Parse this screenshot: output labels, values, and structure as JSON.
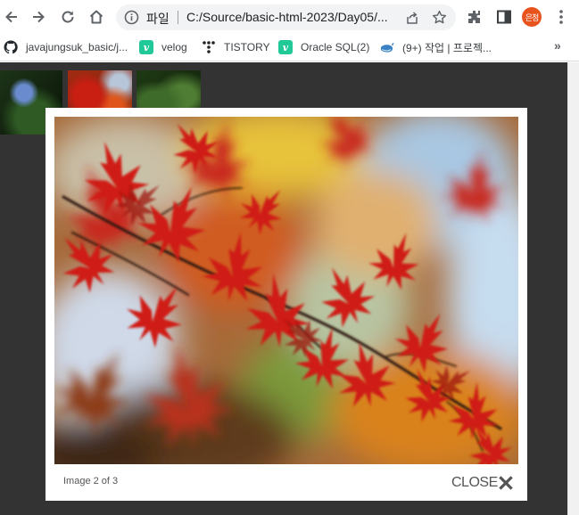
{
  "browser": {
    "address": {
      "scheme_label": "파일",
      "url": "C:/Source/basic-html-2023/Day05/..."
    },
    "profile_initials": "은정",
    "bookmarks": [
      {
        "label": "javajungsuk_basic/j...",
        "icon": "github-icon"
      },
      {
        "label": "velog",
        "icon": "velog-icon"
      },
      {
        "label": "TISTORY",
        "icon": "tistory-icon"
      },
      {
        "label": "Oracle SQL(2)",
        "icon": "velog-icon"
      },
      {
        "label": "(9+) 작업 | 프로젝...",
        "icon": "whale-icon"
      }
    ],
    "bookmarks_more": "»"
  },
  "gallery": {
    "thumbnails": [
      "blue-flower",
      "red-maple",
      "green-leaves"
    ]
  },
  "lightbox": {
    "caption": "Image 2 of 3",
    "close_label": "CLOSE",
    "image_subject": "red maple leaves on branch"
  }
}
